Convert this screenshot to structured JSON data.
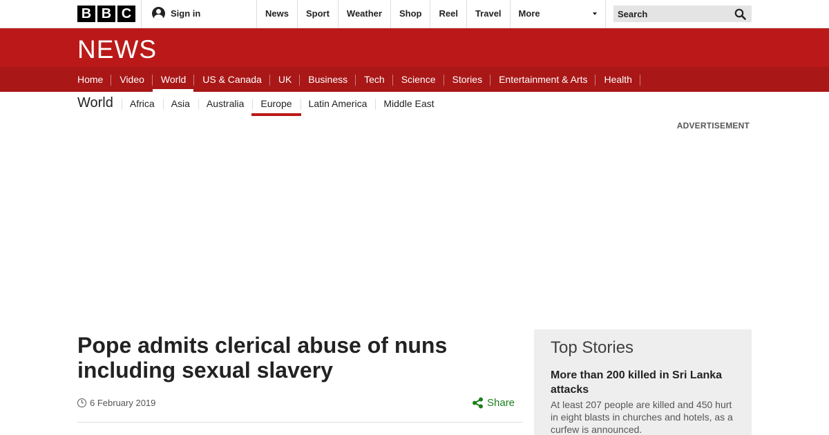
{
  "header": {
    "logo_letters": [
      "B",
      "B",
      "C"
    ],
    "signin_label": "Sign in",
    "nav": [
      "News",
      "Sport",
      "Weather",
      "Shop",
      "Reel",
      "Travel"
    ],
    "more_label": "More",
    "search_placeholder": "Search"
  },
  "news": {
    "title": "NEWS",
    "sections": [
      "Home",
      "Video",
      "World",
      "US & Canada",
      "UK",
      "Business",
      "Tech",
      "Science",
      "Stories",
      "Entertainment & Arts",
      "Health"
    ],
    "active_section": "World"
  },
  "world": {
    "title": "World",
    "regions": [
      "Africa",
      "Asia",
      "Australia",
      "Europe",
      "Latin America",
      "Middle East"
    ],
    "active_region": "Europe"
  },
  "advert_label": "ADVERTISEMENT",
  "article": {
    "headline": "Pope admits clerical abuse of nuns including sexual slavery",
    "date": "6 February 2019",
    "share_label": "Share"
  },
  "top_stories": {
    "heading": "Top Stories",
    "stories": [
      {
        "title": "More than 200 killed in Sri Lanka attacks",
        "summary": "At least 207 people are killed and 450 hurt in eight blasts in churches and hotels, as a curfew is announced."
      }
    ]
  },
  "colors": {
    "brand_red": "#bb1919",
    "nav_red": "#a91717",
    "share_green": "#1a7f1a"
  }
}
